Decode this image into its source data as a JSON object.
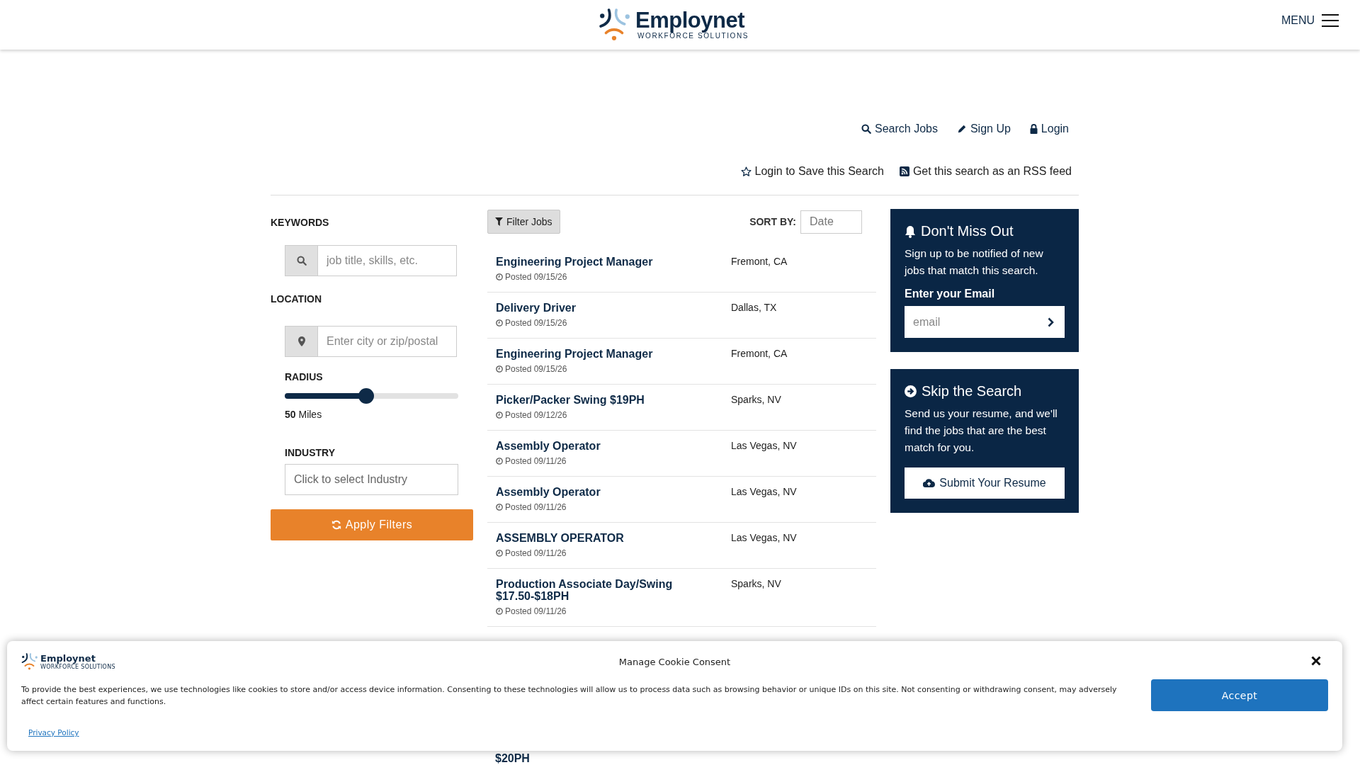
{
  "header": {
    "logo_name": "Employnet",
    "logo_tagline": "WORKFORCE SOLUTIONS",
    "menu_label": "MENU"
  },
  "top_links": [
    {
      "kind": "search",
      "label": "Search Jobs"
    },
    {
      "kind": "signup",
      "label": "Sign Up"
    },
    {
      "kind": "login",
      "label": "Login"
    }
  ],
  "search_actions": [
    {
      "kind": "star",
      "label": "Login to Save this Search"
    },
    {
      "kind": "rss",
      "label": "Get this search as an RSS feed"
    }
  ],
  "filters": {
    "keywords_label": "KEYWORDS",
    "keywords_placeholder": "job title, skills, etc.",
    "location_label": "LOCATION",
    "location_placeholder": "Enter city or zip/postal",
    "radius_label": "RADIUS",
    "radius": {
      "level": 0.47,
      "reading": "**50** Miles"
    },
    "industry_label": "INDUSTRY",
    "industry_placeholder": "Click to select Industry",
    "apply_button": "Apply Filters"
  },
  "results": {
    "filter_button": "Filter Jobs",
    "sort_label": "SORT BY:",
    "sort_value": "Date",
    "jobs": [
      {
        "title": "Engineering Project Manager",
        "posted": "Posted 09/15/26",
        "location": "Fremont, CA"
      },
      {
        "title": "Delivery Driver",
        "posted": "Posted 09/15/26",
        "location": "Dallas, TX"
      },
      {
        "title": "Engineering Project Manager",
        "posted": "Posted 09/15/26",
        "location": "Fremont, CA"
      },
      {
        "title": "Picker/Packer Swing $19PH",
        "posted": "Posted 09/12/26",
        "location": "Sparks, NV"
      },
      {
        "title": "Assembly Operator",
        "posted": "Posted 09/11/26",
        "location": "Las Vegas, NV"
      },
      {
        "title": "Assembly Operator",
        "posted": "Posted 09/11/26",
        "location": "Las Vegas, NV"
      },
      {
        "title": "ASSEMBLY OPERATOR",
        "posted": "Posted 09/11/26",
        "location": "Las Vegas, NV"
      },
      {
        "title": "Production Associate Day/Swing $17.50-$18PH",
        "posted": "Posted 09/11/26",
        "location": "Sparks, NV"
      }
    ],
    "partial_title": "$20PH"
  },
  "sidebar": {
    "alert": {
      "title": "Don't Miss Out",
      "text": "Sign up to be notified of new jobs that match this search.",
      "email_label": "Enter your Email",
      "email_placeholder": "email"
    },
    "resume": {
      "title": "Skip the Search",
      "text": "Send us your resume, and we'll find the jobs that are the best match for you.",
      "button": "Submit Your Resume"
    }
  },
  "cookie_banner": {
    "logo_name": "Employnet",
    "logo_tagline": "WORKFORCE SOLUTIONS",
    "title": "Manage Cookie Consent",
    "text": "To provide the best experiences, we use technologies like cookies to store and/or access device information. Consenting to these technologies will allow us to process data such as browsing behavior or unique IDs on this site. Not consenting or withdrawing consent, may adversely affect certain features and functions.",
    "accept_button": "Accept",
    "privacy_link": "Privacy Policy"
  }
}
